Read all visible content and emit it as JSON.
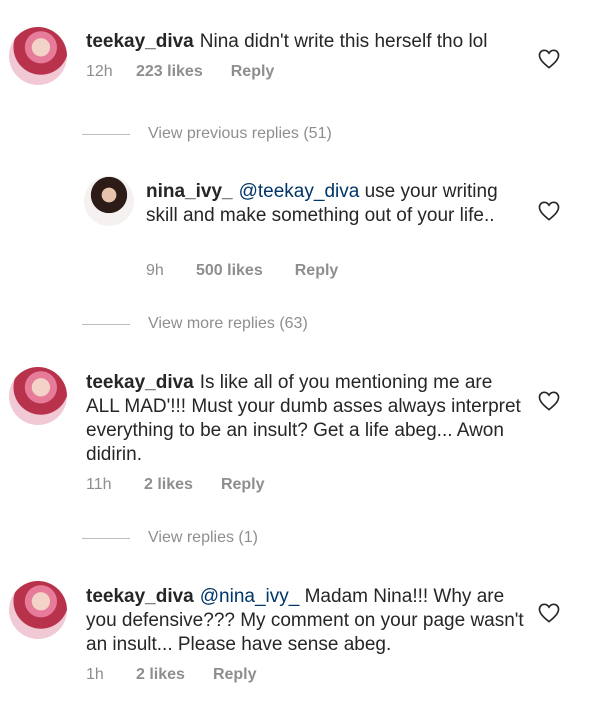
{
  "comments": [
    {
      "username": "teekay_diva",
      "text": "Nina didn't write this herself tho lol",
      "time": "12h",
      "likes": "223 likes",
      "reply": "Reply"
    },
    {
      "username": "nina_ivy_",
      "mention": "@teekay_diva",
      "text": "use your writing skill and make something out of your life..",
      "time": "9h",
      "likes": "500 likes",
      "reply": "Reply"
    },
    {
      "username": "teekay_diva",
      "text": "Is like all of you mentioning me are ALL MAD'!!! Must your dumb asses always interpret everything to be an insult?  Get a life abeg... Awon didirin.",
      "time": "11h",
      "likes": "2 likes",
      "reply": "Reply"
    },
    {
      "username": "teekay_diva",
      "mention": "@nina_ivy_",
      "text": "Madam Nina!!! Why are you defensive??? My comment on your page wasn't an insult... Please have sense abeg.",
      "time": "1h",
      "likes": "2 likes",
      "reply": "Reply"
    }
  ],
  "view_links": {
    "previous": "View previous replies (51)",
    "more": "View more replies (63)",
    "replies": "View replies (1)"
  },
  "icons": {
    "like": "heart-outline-icon"
  }
}
